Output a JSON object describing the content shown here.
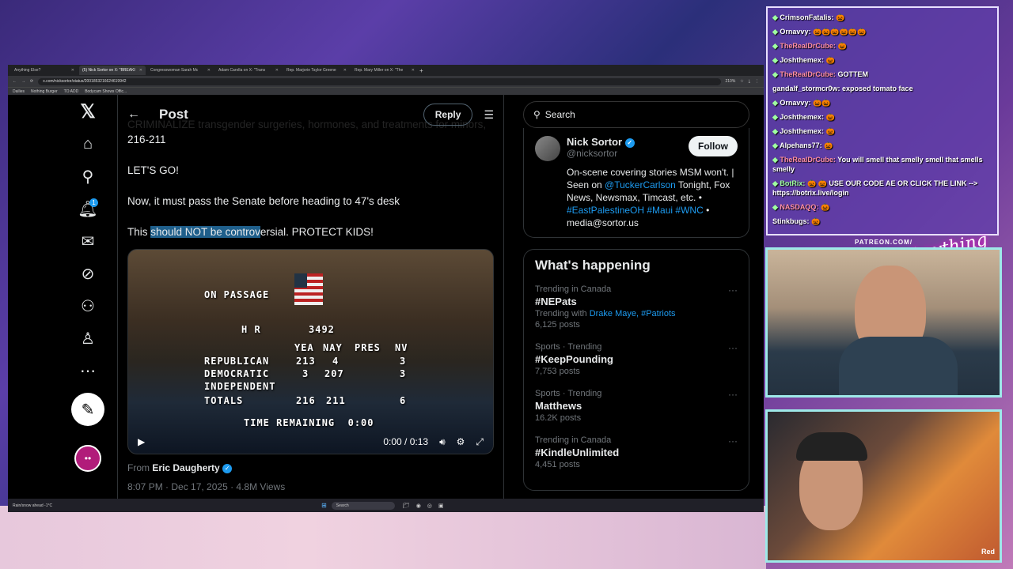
{
  "browser": {
    "tabs": [
      "Anything Else?",
      "(5) Nick Sortor on X: \"BREAKI",
      "Congresswoman Sarah Mc",
      "Adam Carolla on X: \"Trans",
      "Rep. Marjorie Taylor Greene",
      "Rep. Mary Miller on X: \"The"
    ],
    "url": "x.com/nicksortor/status/2001853216624619942",
    "zoom": "210%",
    "bookmarks": [
      "Dailies",
      "Nothing Burger",
      "TO ADD",
      "Bodycam Shows Offic..."
    ]
  },
  "post": {
    "title": "Post",
    "reply_label": "Reply",
    "line_cut": "CRIMINALIZE transgender surgeries, hormones, and treatments for minors, 216-211",
    "p1": "LET'S GO!",
    "p2": "Now, it must pass the Senate before heading to 47's desk",
    "p3_a": "This ",
    "p3_hl": "should NOT be controv",
    "p3_b": "ersial. PROTECT KIDS!",
    "from_label": "From",
    "from_name": "Eric Daugherty",
    "meta": "8:07 PM · Dec 17, 2025 · 4.8M Views"
  },
  "video": {
    "on_passage": "ON PASSAGE",
    "hr_label": "H R",
    "hr_num": "3492",
    "col_yea": "YEA",
    "col_nay": "NAY",
    "col_pres": "PRES",
    "col_nv": "NV",
    "r_label": "REPUBLICAN",
    "r_yea": "213",
    "r_nay": "4",
    "r_nv": "3",
    "d_label": "DEMOCRATIC",
    "d_yea": "3",
    "d_nay": "207",
    "d_nv": "3",
    "i_label": "INDEPENDENT",
    "t_label": "TOTALS",
    "t_yea": "216",
    "t_nay": "211",
    "t_nv": "6",
    "time_remaining": "TIME REMAINING  0:00",
    "time": "0:00 / 0:13"
  },
  "sidebar": {
    "search_placeholder": "Search",
    "profile_name": "Nick Sortor",
    "profile_handle": "@nicksortor",
    "follow_label": "Follow",
    "bio_1": "On-scene covering stories MSM won't. | Seen on ",
    "bio_link": "@TuckerCarlson",
    "bio_2": " Tonight, Fox News, Newsmax, Timcast, etc. •",
    "bio_tags": "#EastPalestineOH #Maui #WNC",
    "bio_3": " •",
    "bio_email": "media@sortor.us",
    "whats_happening": "What's happening",
    "trends": [
      {
        "context": "Trending in Canada",
        "name": "#NEPats",
        "sub_label": "Trending with",
        "sub_links": "Drake Maye, #Patriots",
        "posts": "6,125 posts"
      },
      {
        "context": "Sports · Trending",
        "name": "#KeepPounding",
        "posts": "7,753 posts"
      },
      {
        "context": "Sports · Trending",
        "name": "Matthews",
        "posts": "16.2K posts"
      },
      {
        "context": "Trending in Canada",
        "name": "#KindleUnlimited",
        "posts": "4,451 posts"
      }
    ]
  },
  "taskbar": {
    "weather": "Rain/snow ahead",
    "temp": "-1°C",
    "search": "Search"
  },
  "chat": [
    {
      "name": "CrimsonFatalis:",
      "text": "🎃"
    },
    {
      "name": "Ornavvy:",
      "text": "🎃🎃🎃🎃🎃🎃"
    },
    {
      "name": "TheRealDrCube:",
      "text": "🎃"
    },
    {
      "name": "Joshthemex:",
      "text": "🎃"
    },
    {
      "name": "TheRealDrCube:",
      "text": "GOTTEM"
    },
    {
      "name": "gandalf_stormcr0w:",
      "text": "exposed tomato face"
    },
    {
      "name": "Ornavvy:",
      "text": "🎃🎃"
    },
    {
      "name": "Joshthemex:",
      "text": "🎃"
    },
    {
      "name": "Joshthemex:",
      "text": "🎃"
    },
    {
      "name": "Alpehans77:",
      "text": "🎃"
    },
    {
      "name": "TheRealDrCube:",
      "text": "You will smell that smelly smell that smells smelly"
    },
    {
      "name": "BotRix:",
      "text": "🎃 🎃 USE OUR CODE AE OR CLICK THE LINK --> https://botrix.live/login"
    },
    {
      "name": "NASDAQQ:",
      "text": "🎃"
    },
    {
      "name": "Stinkbugs:",
      "text": "🎃"
    }
  ],
  "overlay": {
    "patreon": "PATREON.COM/",
    "logo": "Anything Else?",
    "rec": "Red"
  },
  "colors": {
    "accent": "#1d9bf0",
    "highlight": "#1f5f8b"
  }
}
